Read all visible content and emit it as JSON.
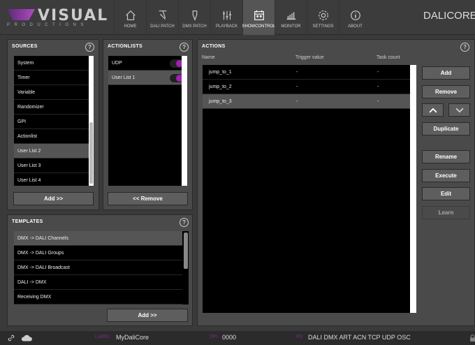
{
  "logo": {
    "word": "VISUAL",
    "sub": "PRODUCTIONS"
  },
  "nav": [
    {
      "label": "HOME",
      "icon": "home-icon"
    },
    {
      "label": "DALI PATCH",
      "icon": "dali-patch-icon"
    },
    {
      "label": "DMX PATCH",
      "icon": "dmx-patch-icon"
    },
    {
      "label": "PLAYBACK",
      "icon": "playback-icon"
    },
    {
      "label": "SHOWCONTROL",
      "icon": "showcontrol-icon"
    },
    {
      "label": "MONITOR",
      "icon": "monitor-icon"
    },
    {
      "label": "SETTINGS",
      "icon": "settings-icon"
    },
    {
      "label": "ABOUT",
      "icon": "about-icon"
    }
  ],
  "brand": "DALICORE",
  "sources": {
    "title": "SOURCES",
    "items": [
      "System",
      "Timer",
      "Variable",
      "Randomizer",
      "GPI",
      "Actionlist",
      "User List 2",
      "User List 3",
      "User List 4"
    ],
    "selected": "User List 2",
    "add_label": "Add >>"
  },
  "actionlists": {
    "title": "ACTIONLISTS",
    "items": [
      "UDP",
      "User List 1"
    ],
    "remove_label": "<< Remove"
  },
  "templates": {
    "title": "TEMPLATES",
    "items": [
      "DMX -> DALI Channels",
      "DMX -> DALI Groups",
      "DMX -> DALI Broadcast",
      "DALI -> DMX",
      "Receiving DMX"
    ],
    "add_label": "Add >>"
  },
  "actions": {
    "title": "ACTIONS",
    "columns": [
      "Name",
      "Trigger value",
      "Task count"
    ],
    "rows": [
      [
        "jump_to_1",
        "-",
        "-"
      ],
      [
        "jump_to_2",
        "-",
        "-"
      ],
      [
        "jump_to_3",
        "-",
        "-"
      ]
    ],
    "buttons": {
      "add": "Add",
      "remove": "Remove",
      "duplicate": "Duplicate",
      "rename": "Rename",
      "execute": "Execute",
      "edit": "Edit",
      "learn": "Learn"
    }
  },
  "help_glyph": "?",
  "status": {
    "label_title": "LABEL",
    "label_value": "MyDaliCore",
    "dpi_title": "DPI",
    "dpi_value": "0000",
    "rx_title": "RX",
    "rx_value": "DALI DMX ART ACN TCP UDP OSC"
  }
}
